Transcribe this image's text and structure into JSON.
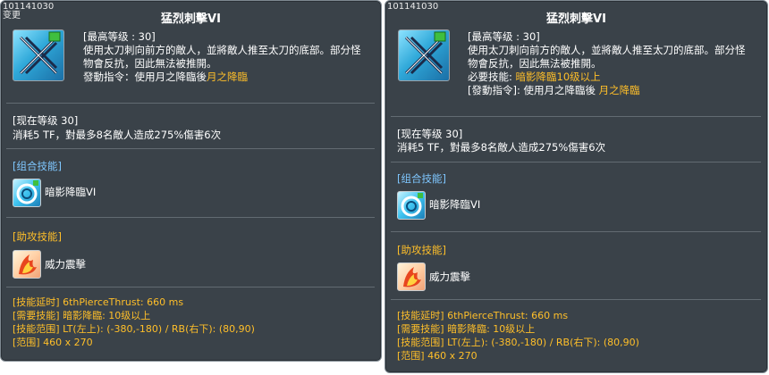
{
  "left_panel": {
    "id_tag": "101141030",
    "change_tag": "变更",
    "title": "猛烈刺擊VI",
    "icon": "crossed-blades-skill-icon",
    "max_level_line": "[最高等级 : 30]",
    "desc_line1": "使用太刀刺向前方的敵人，並將敵人推至太刀的底部。部分怪",
    "desc_line2": "物會反抗，因此無法被推開。",
    "trigger_label": "發動指令：使用月之降臨後",
    "trigger_skill": "月之降臨",
    "current_level": "[现在等级 30]",
    "effect": "消耗5 TF，對最多8名敵人造成275%傷害6次",
    "combo_header": "[组合技能]",
    "combo_skill": "暗影降臨VI",
    "assist_header": "[助攻技能]",
    "assist_skill": "威力震擊",
    "info_lines": [
      "[技能延时] 6thPierceThrust: 660 ms",
      "[需要技能] 暗影降臨: 10级以上",
      "[技能范围] LT(左上): (-380,-180) / RB(右下): (80,90)",
      "[范围] 460 x 270"
    ]
  },
  "right_panel": {
    "id_tag": "101141030",
    "title": "猛烈刺擊VI",
    "icon": "crossed-blades-skill-icon",
    "max_level_line": "[最高等级 : 30]",
    "desc_line1": "使用太刀刺向前方的敵人，並將敵人推至太刀的底部。部分怪",
    "desc_line2": "物會反抗，因此無法被推開。",
    "required_label": "必要技能: ",
    "required_value": "暗影降臨10级以上",
    "trigger_label": "[發動指令]: 使用月之降臨後 ",
    "trigger_skill": "月之降臨",
    "current_level": "[现在等级 30]",
    "effect": "消耗5 TF，對最多8名敵人造成275%傷害6次",
    "combo_header": "[组合技能]",
    "combo_skill": "暗影降臨VI",
    "assist_header": "[助攻技能]",
    "assist_skill": "威力震擊",
    "info_lines": [
      "[技能延时] 6thPierceThrust: 660 ms",
      "[需要技能] 暗影降臨: 10级以上",
      "[技能范围] LT(左上): (-380,-180) / RB(右下): (80,90)",
      "[范围] 460 x 270"
    ]
  },
  "colors": {
    "panel_bg": "#3a4249",
    "highlight": "#ffbf29",
    "section_blue": "#7fc7ff"
  }
}
